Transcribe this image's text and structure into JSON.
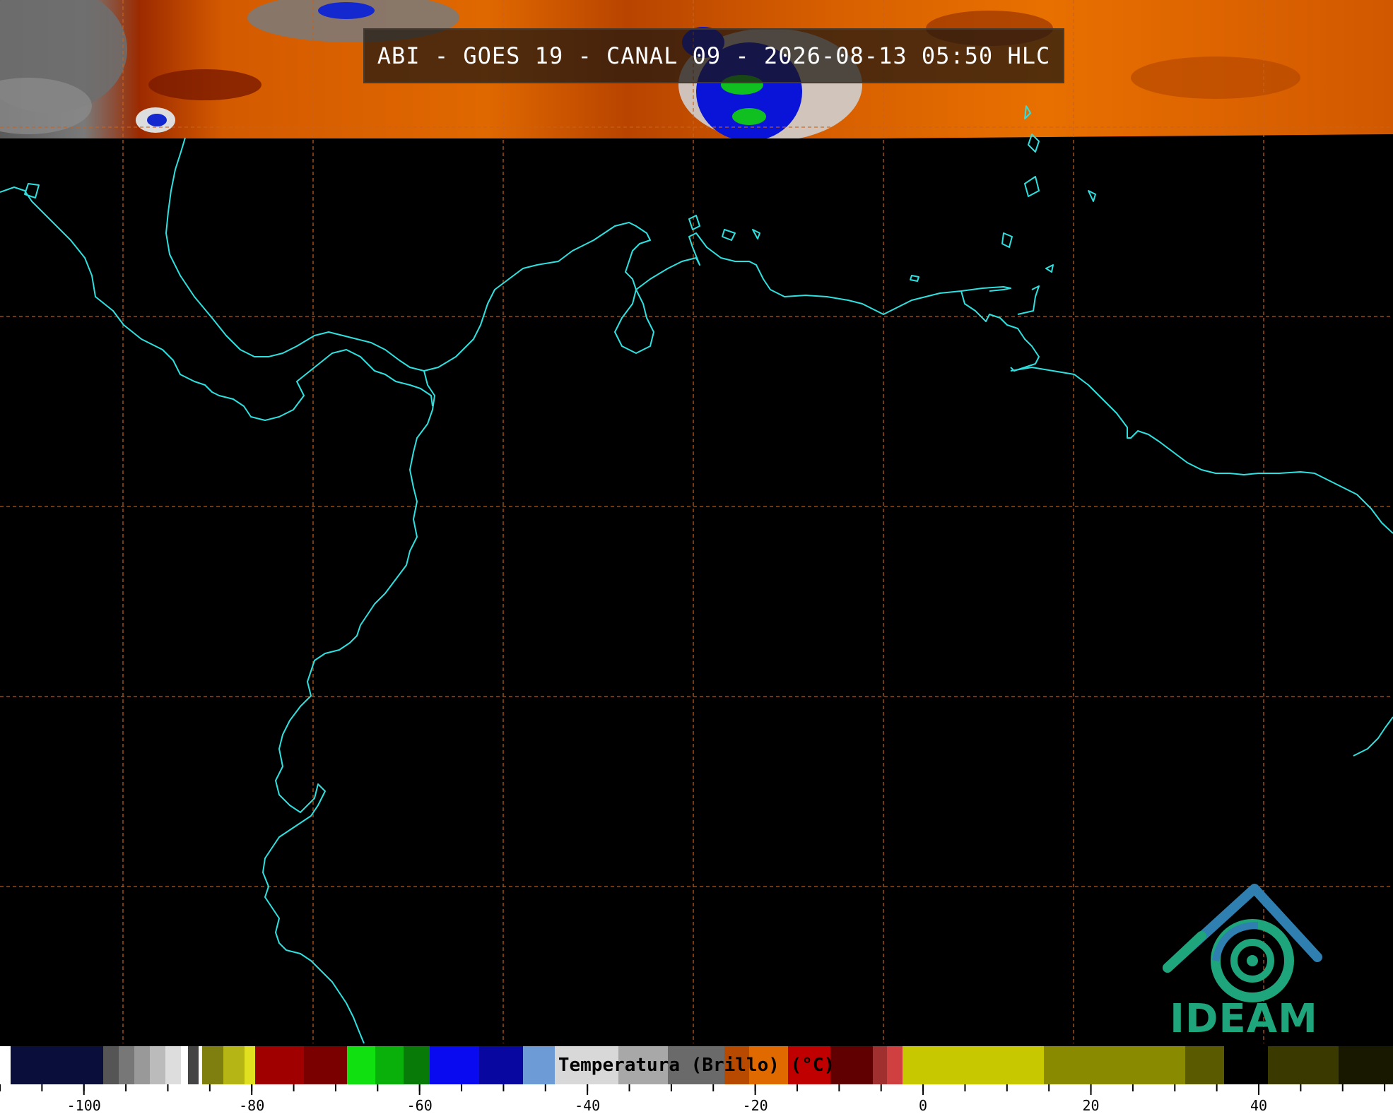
{
  "title": "ABI - GOES 19 - CANAL 09 - 2026-08-13 05:50 HLC",
  "colorbar": {
    "label": "Temperatura (Brillo) (°C)",
    "ticks": [
      -100,
      -80,
      -60,
      -40,
      -20,
      0,
      20,
      40
    ],
    "range": [
      -110,
      56
    ]
  },
  "logo": {
    "text": "IDEAM"
  },
  "colors": {
    "coastline": "#2fe0e0",
    "graticule": "#c8631e",
    "cloud_warm": "#e06a00",
    "background": "#000000"
  }
}
